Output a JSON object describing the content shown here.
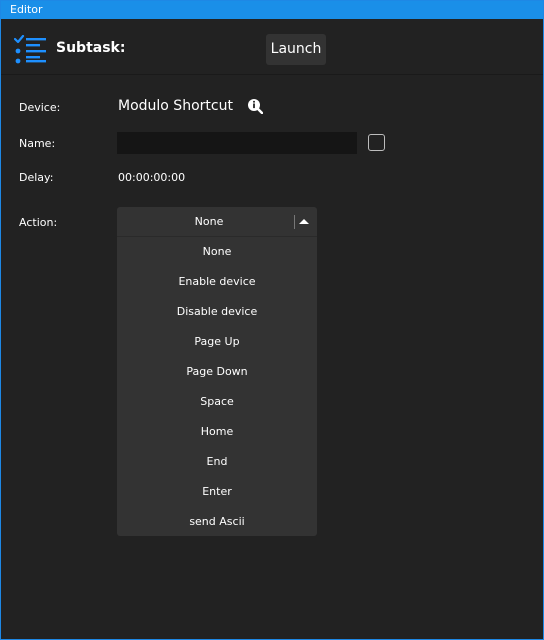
{
  "window": {
    "title": "Editor"
  },
  "header": {
    "icon": "task-list-icon",
    "subtask_label": "Subtask:",
    "launch_label": "Launch"
  },
  "form": {
    "device_label": "Device:",
    "device_value": "Modulo Shortcut",
    "device_info_icon": "info-icon",
    "name_label": "Name:",
    "name_value": "",
    "name_checkbox_checked": false,
    "delay_label": "Delay:",
    "delay_value": "00:00:00:00",
    "action_label": "Action:",
    "action_selected": "None",
    "action_options": [
      "None",
      "Enable device",
      "Disable device",
      "Page Up",
      "Page Down",
      "Space",
      "Home",
      "End",
      "Enter",
      "send Ascii"
    ]
  },
  "colors": {
    "accent": "#1a8fe8",
    "background": "#222222",
    "control": "#333333",
    "input": "#151515"
  }
}
